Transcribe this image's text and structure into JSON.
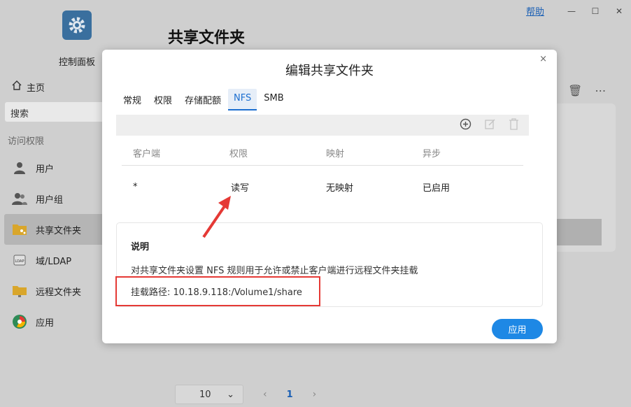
{
  "window": {
    "help": "帮助",
    "minimize": "—",
    "maximize": "☐",
    "close": "✕"
  },
  "app": {
    "name": "控制面板",
    "page_title": "共享文件夹"
  },
  "sidebar": {
    "home": "主页",
    "search_placeholder": "搜索",
    "group": "访问权限",
    "items": [
      {
        "label": "用户",
        "icon": "user-icon"
      },
      {
        "label": "用户组",
        "icon": "user-group-icon"
      },
      {
        "label": "共享文件夹",
        "icon": "shared-folder-icon",
        "active": true
      },
      {
        "label": "域/LDAP",
        "icon": "ldap-icon"
      },
      {
        "label": "远程文件夹",
        "icon": "remote-folder-icon"
      },
      {
        "label": "应用",
        "icon": "app-icon"
      }
    ]
  },
  "pager": {
    "page_size": "10",
    "prev": "‹",
    "page": "1",
    "next": "›"
  },
  "modal": {
    "title": "编辑共享文件夹",
    "close": "×",
    "tabs": [
      "常规",
      "权限",
      "存储配额",
      "NFS",
      "SMB"
    ],
    "active_tab": "NFS",
    "table": {
      "headers": [
        "客户端",
        "权限",
        "映射",
        "异步"
      ],
      "rows": [
        [
          "*",
          "读写",
          "无映射",
          "已启用"
        ]
      ]
    },
    "info": {
      "title": "说明",
      "description": "对共享文件夹设置 NFS 规则用于允许或禁止客户端进行远程文件夹挂载",
      "mount_path": "挂载路径: 10.18.9.118:/Volume1/share"
    },
    "apply": "应用"
  },
  "colors": {
    "accent": "#1e88e5",
    "annotation": "#e53935"
  }
}
